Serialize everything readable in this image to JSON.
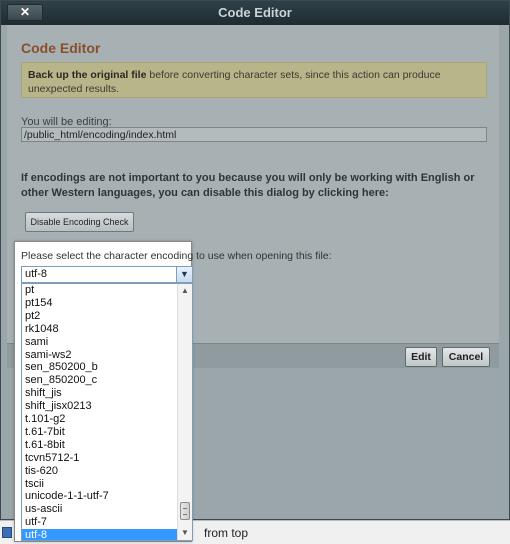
{
  "window": {
    "title": "Code Editor",
    "close_label": "✕"
  },
  "panel": {
    "heading": "Code Editor",
    "warning_bold": "Back up the original file",
    "warning_text": " before converting character sets, since this action can produce unexpected results.",
    "editing_label": "You will be editing:",
    "file_path": "/public_html/encoding/index.html",
    "note": "If encodings are not important to you because you will only be working with English or other Western languages, you can disable this dialog by clicking here:",
    "disable_button": "Disable Encoding Check"
  },
  "footer": {
    "edit_button": "Edit",
    "cancel_button": "Cancel"
  },
  "encoding": {
    "prompt": "Please select the character encoding to use when opening this file:",
    "selected_value": "utf-8",
    "options": [
      "pt",
      "pt154",
      "pt2",
      "rk1048",
      "sami",
      "sami-ws2",
      "sen_850200_b",
      "sen_850200_c",
      "shift_jis",
      "shift_jisx0213",
      "t.101-g2",
      "t.61-7bit",
      "t.61-8bit",
      "tcvn5712-1",
      "tis-620",
      "tscii",
      "unicode-1-1-utf-7",
      "us-ascii",
      "utf-7",
      "utf-8"
    ],
    "highlighted_option": "utf-8"
  },
  "background": {
    "from_top_text": "from top"
  },
  "icons": {
    "dropdown": "chevron-down-icon",
    "scroll_up": "arrow-up-icon",
    "scroll_down": "arrow-down-icon"
  }
}
